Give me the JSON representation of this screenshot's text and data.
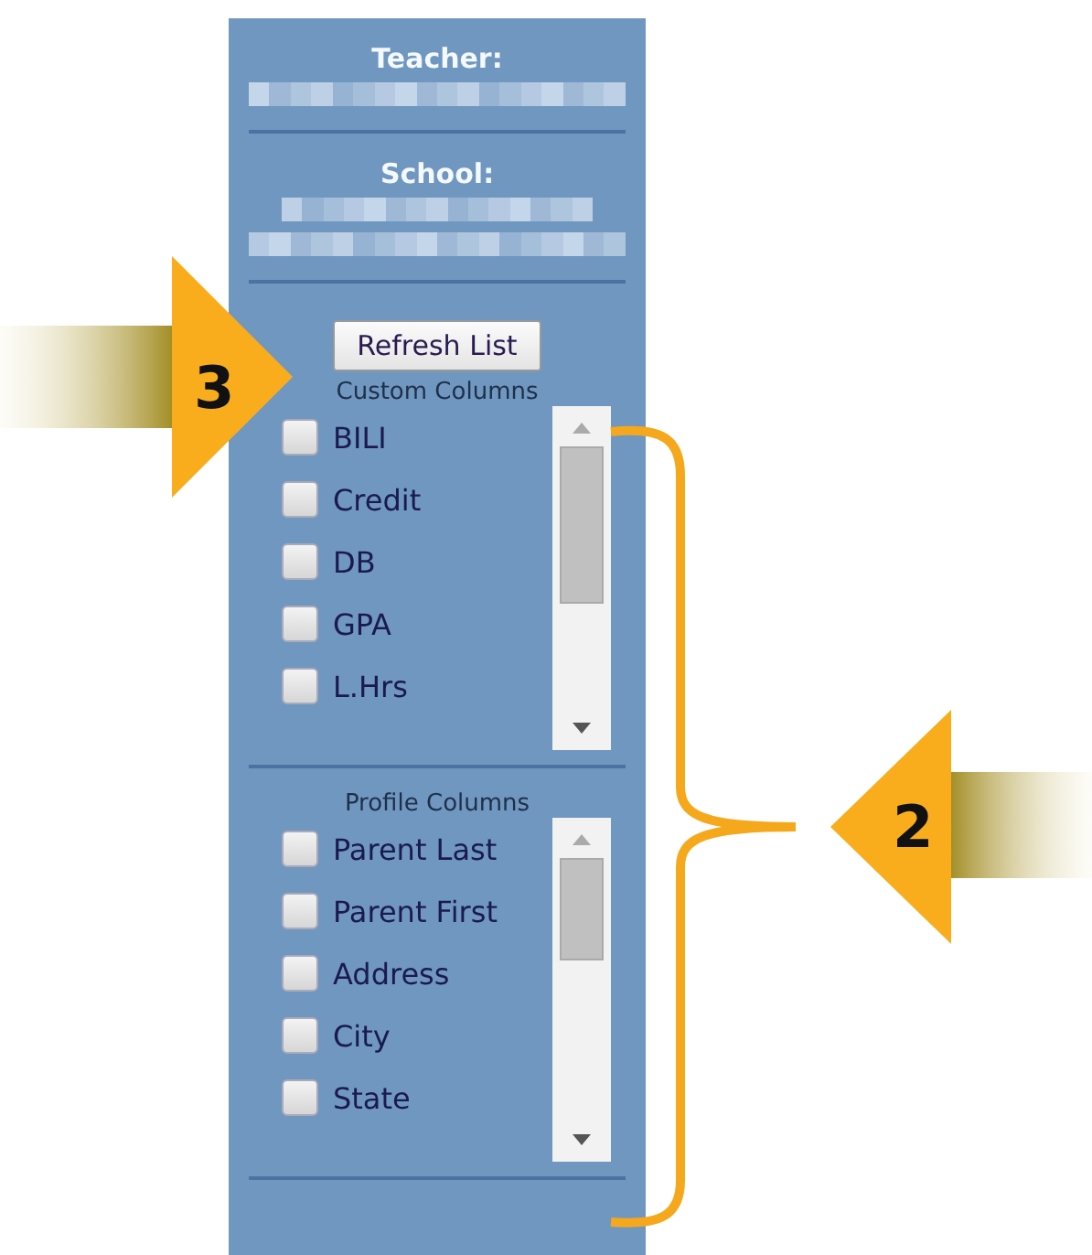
{
  "teacher_label": "Teacher:",
  "school_label": "School:",
  "refresh_button": "Refresh List",
  "custom_columns": {
    "title": "Custom Columns",
    "items": [
      {
        "label": "BILI",
        "checked": false
      },
      {
        "label": "Credit",
        "checked": false
      },
      {
        "label": "DB",
        "checked": false
      },
      {
        "label": "GPA",
        "checked": false
      },
      {
        "label": "L.Hrs",
        "checked": false
      }
    ]
  },
  "profile_columns": {
    "title": "Profile Columns",
    "items": [
      {
        "label": "Parent Last",
        "checked": false
      },
      {
        "label": "Parent First",
        "checked": false
      },
      {
        "label": "Address",
        "checked": false
      },
      {
        "label": "City",
        "checked": false
      },
      {
        "label": "State",
        "checked": false
      }
    ]
  },
  "callouts": [
    {
      "number": "3"
    },
    {
      "number": "2"
    }
  ]
}
